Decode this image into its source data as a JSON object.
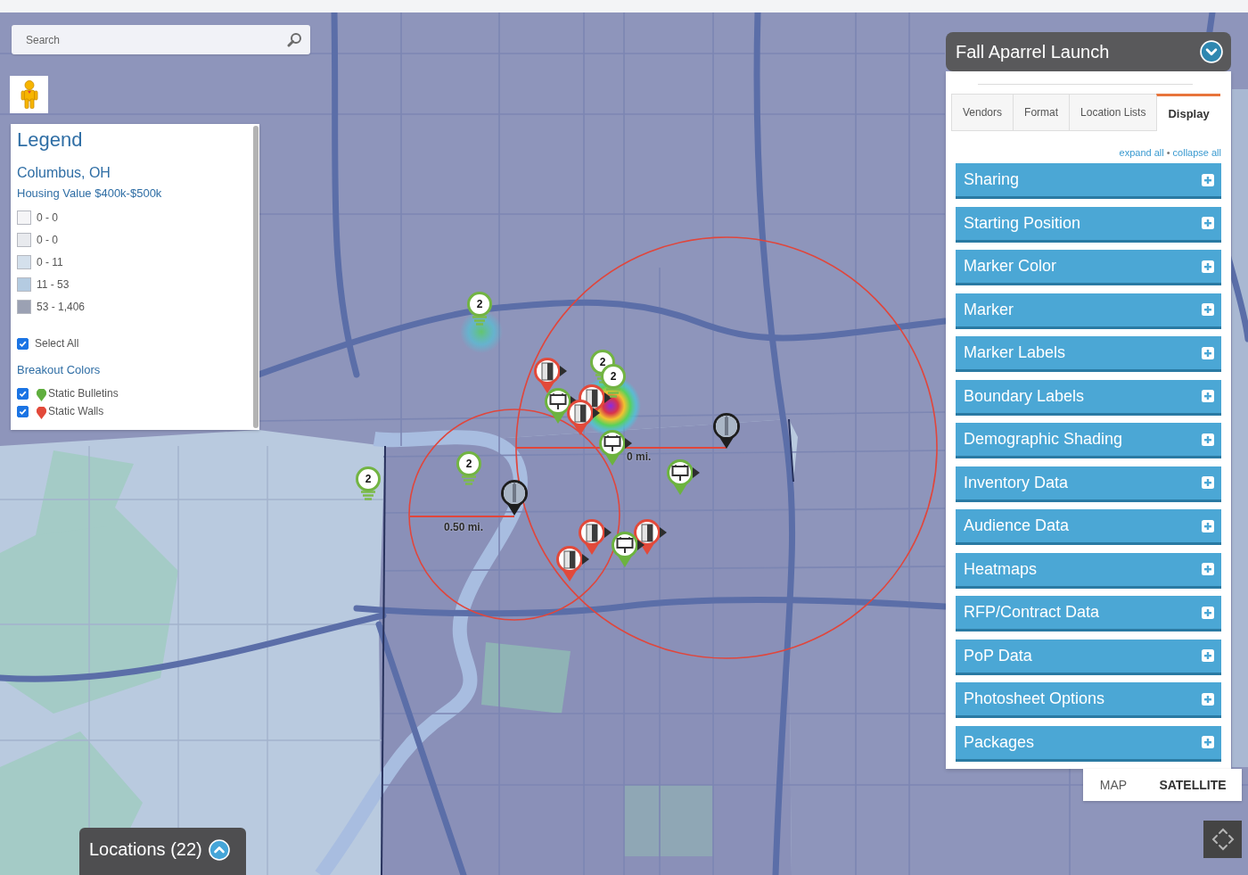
{
  "search": {
    "placeholder": "Search"
  },
  "legend": {
    "title": "Legend",
    "city": "Columbus, OH",
    "layer": "Housing Value $400k-$500k",
    "ranges": [
      {
        "label": "0 - 0",
        "color": "#f5f5f7"
      },
      {
        "label": "0 - 0",
        "color": "#e8eaee"
      },
      {
        "label": "0 - 11",
        "color": "#d4e0ec"
      },
      {
        "label": "11 - 53",
        "color": "#b4cbe1"
      },
      {
        "label": "53 - 1,406",
        "color": "#9ba1b3"
      }
    ],
    "select_all": {
      "label": "Select All",
      "checked": true
    },
    "breakout_title": "Breakout Colors",
    "breakouts": [
      {
        "label": "Static Bulletins",
        "checked": true,
        "color": "#5fae3e"
      },
      {
        "label": "Static Walls",
        "checked": true,
        "color": "#e2493a"
      }
    ]
  },
  "map": {
    "clusters": [
      {
        "count": "2"
      },
      {
        "count": "2"
      },
      {
        "count": "2"
      },
      {
        "count": "2"
      },
      {
        "count": "2"
      }
    ],
    "markers": [
      {
        "kind": "wall"
      },
      {
        "kind": "wall"
      },
      {
        "kind": "bulletin"
      },
      {
        "kind": "wall"
      },
      {
        "kind": "landmark"
      },
      {
        "kind": "bulletin"
      },
      {
        "kind": "bulletin"
      },
      {
        "kind": "landmark"
      },
      {
        "kind": "wall"
      },
      {
        "kind": "wall"
      },
      {
        "kind": "bulletin"
      },
      {
        "kind": "wall"
      }
    ],
    "radius_labels": [
      "0.50 mi.",
      "0 mi."
    ]
  },
  "panel": {
    "title": "Fall Aparrel Launch",
    "expanded": true,
    "tabs": [
      {
        "label": "Vendors",
        "selected": false
      },
      {
        "label": "Format",
        "selected": false
      },
      {
        "label": "Location Lists",
        "selected": false
      },
      {
        "label": "Display",
        "selected": true
      }
    ],
    "expand_all": "expand all",
    "separator": "•",
    "collapse_all": "collapse all",
    "sections": [
      {
        "label": "Sharing",
        "expanded": false
      },
      {
        "label": "Starting Position",
        "expanded": false
      },
      {
        "label": "Marker Color",
        "expanded": false
      },
      {
        "label": "Marker",
        "expanded": false
      },
      {
        "label": "Marker Labels",
        "expanded": false
      },
      {
        "label": "Boundary Labels",
        "expanded": false
      },
      {
        "label": "Demographic Shading",
        "expanded": false
      },
      {
        "label": "Inventory Data",
        "expanded": false
      },
      {
        "label": "Audience Data",
        "expanded": false
      },
      {
        "label": "Heatmaps",
        "expanded": false
      },
      {
        "label": "RFP/Contract Data",
        "expanded": false
      },
      {
        "label": "PoP Data",
        "expanded": false
      },
      {
        "label": "Photosheet Options",
        "expanded": false
      },
      {
        "label": "Packages",
        "expanded": false
      }
    ]
  },
  "map_type": [
    {
      "label": "MAP",
      "selected": false
    },
    {
      "label": "SATELLITE",
      "selected": true
    }
  ],
  "locations": {
    "label": "Locations (22)",
    "expanded": false
  }
}
